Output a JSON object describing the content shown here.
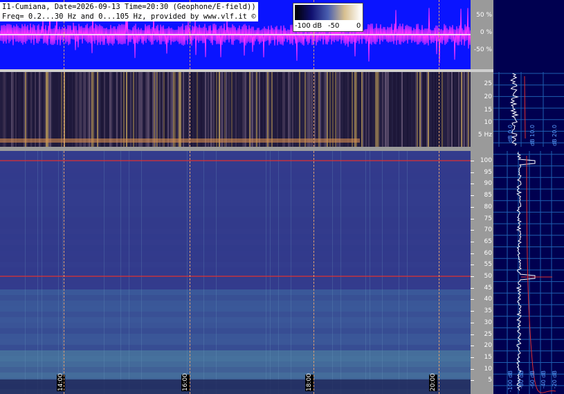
{
  "header": {
    "line1": "I1-Cumiana, Date=2026-09-13 Time=20:30 (Geophone/E-field))",
    "line2": "Freq= 0.2...30 Hz and 0...105 Hz, provided by www.vlf.it ©"
  },
  "colorbar": {
    "labels": [
      "-100 dB",
      "-50",
      "0"
    ]
  },
  "waveform": {
    "ticks": [
      "50 %",
      "0 %",
      "-50 %"
    ],
    "colors": {
      "background": "#0a14ff",
      "trace": "#ff33ff",
      "center": "#ffffff"
    }
  },
  "spectrogram_low": {
    "ticks": [
      "25",
      "20",
      "15",
      "10",
      "5 Hz"
    ]
  },
  "spectrogram_main": {
    "ticks": [
      "100",
      "95",
      "90",
      "85",
      "80",
      "75",
      "70",
      "65",
      "60",
      "55",
      "50",
      "45",
      "40",
      "35",
      "30",
      "25",
      "20",
      "15",
      "10",
      "5"
    ],
    "marker_lines": [
      {
        "freq_hz": 100,
        "color": "#e03030"
      },
      {
        "freq_hz": 50,
        "color": "#e03030"
      }
    ]
  },
  "time_axis": {
    "labels": [
      "14:00",
      "16:00",
      "18:00",
      "20:00"
    ]
  },
  "right_panel": {
    "top_labels": [
      "dB 0.0",
      "dB 10.0",
      "dB 20.0"
    ],
    "bottom_labels": [
      "-100 dB",
      "-80 dB",
      "-60 dB",
      "-40 dB",
      "-20 dB"
    ],
    "colors": {
      "background": "#000050",
      "grid": "#1e5fb0",
      "trace": "#ffffff",
      "fit": "#e03030"
    }
  }
}
